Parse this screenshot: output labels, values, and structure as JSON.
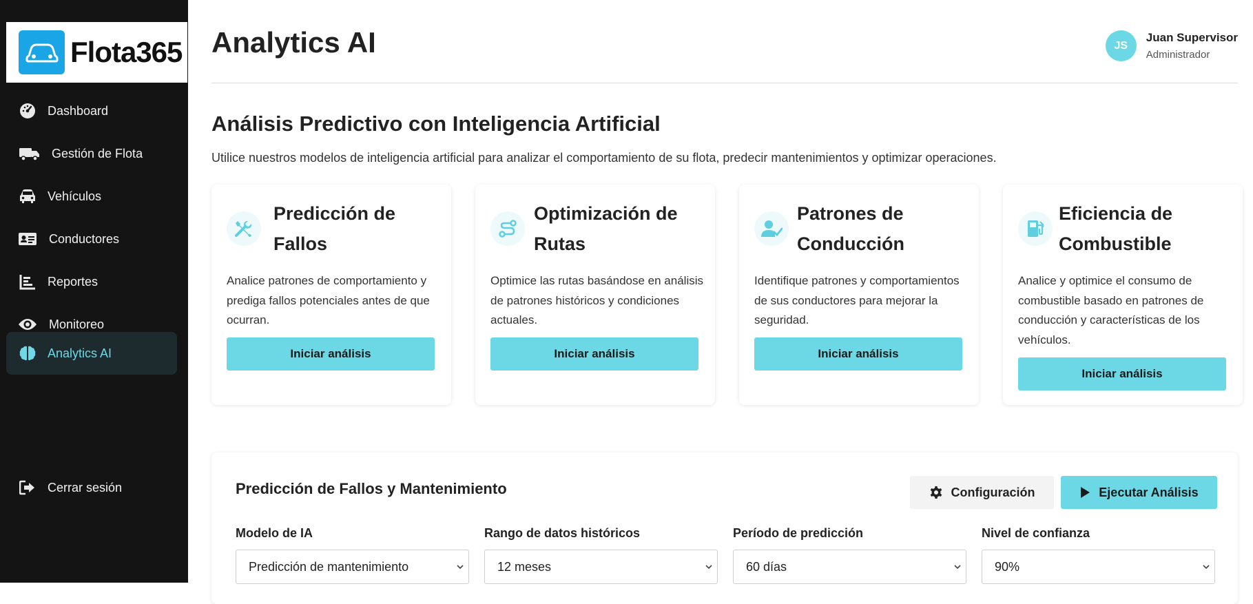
{
  "brand": {
    "name": "Flota365",
    "accent": "#6cd8e6",
    "logo_color": "#1aa6e6"
  },
  "sidebar": {
    "items": [
      {
        "label": "Dashboard",
        "icon": "gauge-icon",
        "active": false
      },
      {
        "label": "Gestión de Flota",
        "icon": "truck-icon",
        "active": false
      },
      {
        "label": "Vehículos",
        "icon": "car-icon",
        "active": false
      },
      {
        "label": "Conductores",
        "icon": "id-card-icon",
        "active": false
      },
      {
        "label": "Reportes",
        "icon": "bar-chart-icon",
        "active": false
      },
      {
        "label": "Monitoreo",
        "icon": "eye-icon",
        "active": false
      },
      {
        "label": "Analytics AI",
        "icon": "brain-icon",
        "active": true
      }
    ],
    "logout": {
      "label": "Cerrar sesión",
      "icon": "sign-out-icon"
    }
  },
  "header": {
    "title": "Analytics AI",
    "user": {
      "initials": "JS",
      "name": "Juan Supervisor",
      "role": "Administrador"
    }
  },
  "intro": {
    "title": "Análisis Predictivo con Inteligencia Artificial",
    "description": "Utilice nuestros modelos de inteligencia artificial para analizar el comportamiento de su flota, predecir mantenimientos y optimizar operaciones."
  },
  "cards": [
    {
      "title": "Predicción de Fallos",
      "icon": "tools-icon",
      "description": "Analice patrones de comportamiento y prediga fallos potenciales antes de que ocurran.",
      "button": "Iniciar análisis"
    },
    {
      "title": "Optimización de Rutas",
      "icon": "route-icon",
      "description": "Optimice las rutas basándose en análisis de patrones históricos y condiciones actuales.",
      "button": "Iniciar análisis"
    },
    {
      "title": "Patrones de Conducción",
      "icon": "user-check-icon",
      "description": "Identifique patrones y comportamientos de sus conductores para mejorar la seguridad.",
      "button": "Iniciar análisis"
    },
    {
      "title": "Eficiencia de Combustible",
      "icon": "fuel-pump-icon",
      "description": "Analice y optimice el consumo de combustible basado en patrones de conducción y características de los vehículos.",
      "button": "Iniciar análisis"
    }
  ],
  "panel": {
    "title": "Predicción de Fallos y Mantenimiento",
    "config_label": "Configuración",
    "run_label": "Ejecutar Análisis",
    "fields": [
      {
        "label": "Modelo de IA",
        "value": "Predicción de mantenimiento"
      },
      {
        "label": "Rango de datos históricos",
        "value": "12 meses"
      },
      {
        "label": "Período de predicción",
        "value": "60 días"
      },
      {
        "label": "Nivel de confianza",
        "value": "90%"
      }
    ]
  }
}
